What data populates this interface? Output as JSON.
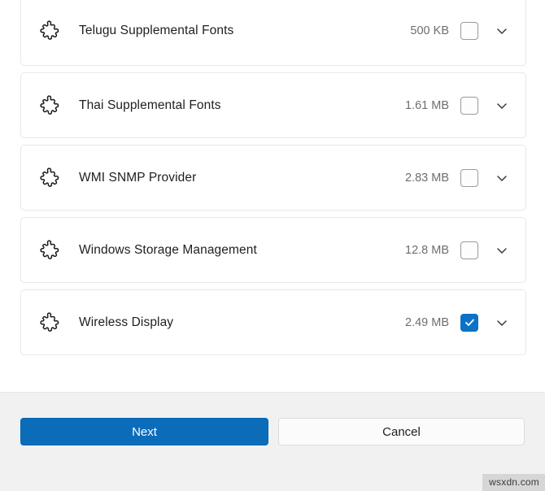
{
  "window": {
    "accent_color": "#0b6cba",
    "checkbox_checked_color": "#0c72c5",
    "footer_background": "#f1f1f1",
    "card_background": "#ffffff"
  },
  "feature_list": {
    "icon_name": "puzzle-piece-icon",
    "expand_icon_name": "chevron-down-icon",
    "rows": [
      {
        "label": "Telugu Supplemental Fonts",
        "size": "500 KB",
        "checked": false
      },
      {
        "label": "Thai Supplemental Fonts",
        "size": "1.61 MB",
        "checked": false
      },
      {
        "label": "WMI SNMP Provider",
        "size": "2.83 MB",
        "checked": false
      },
      {
        "label": "Windows Storage Management",
        "size": "12.8 MB",
        "checked": false
      },
      {
        "label": "Wireless Display",
        "size": "2.49 MB",
        "checked": true
      }
    ]
  },
  "footer": {
    "next_label": "Next",
    "cancel_label": "Cancel"
  },
  "watermark": {
    "text": "wsxdn.com"
  }
}
